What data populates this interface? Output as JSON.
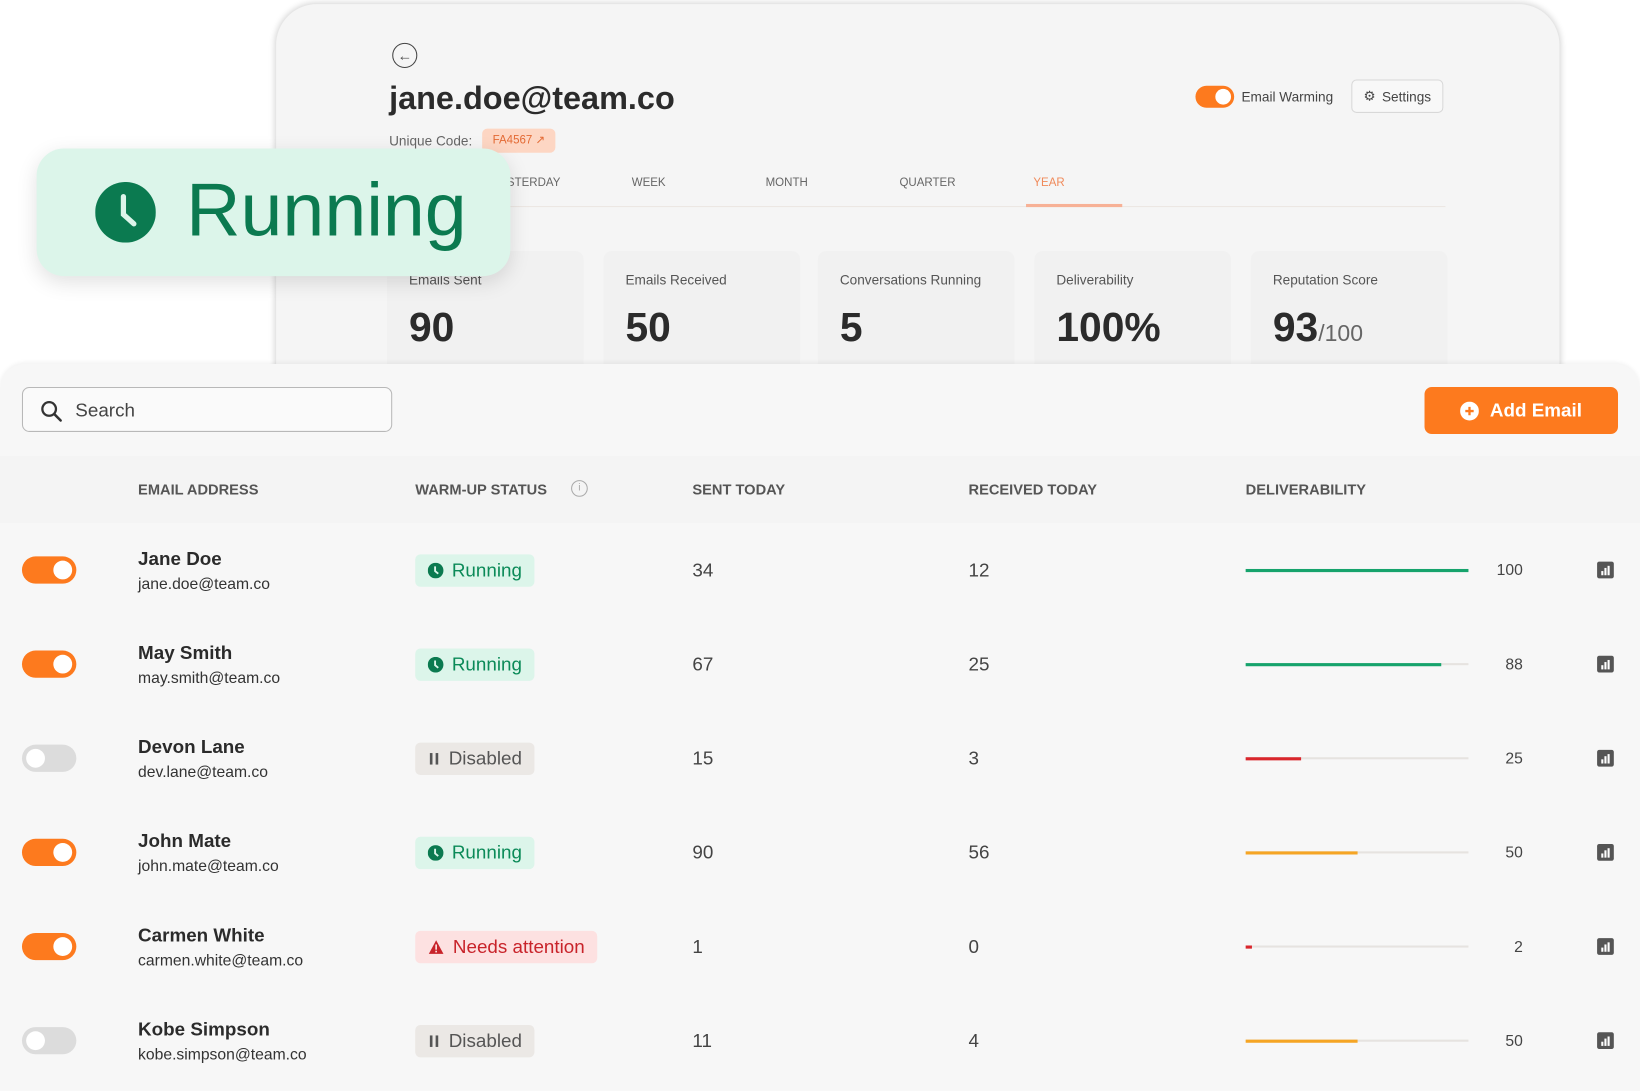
{
  "detail": {
    "title": "jane.doe@team.co",
    "unique_code_label": "Unique Code:",
    "unique_code": "FA4567 ↗",
    "email_warming_label": "Email Warming",
    "email_warming_on": true,
    "settings_label": "Settings",
    "tabs": [
      {
        "label": "YESTERDAY",
        "active": false
      },
      {
        "label": "WEEK",
        "active": false
      },
      {
        "label": "MONTH",
        "active": false
      },
      {
        "label": "QUARTER",
        "active": false
      },
      {
        "label": "YEAR",
        "active": true
      }
    ],
    "stats": [
      {
        "label": "Emails Sent",
        "value": "90",
        "suffix": ""
      },
      {
        "label": "Emails Received",
        "value": "50",
        "suffix": ""
      },
      {
        "label": "Conversations Running",
        "value": "5",
        "suffix": ""
      },
      {
        "label": "Deliverability",
        "value": "100%",
        "suffix": ""
      },
      {
        "label": "Reputation Score",
        "value": "93",
        "suffix": "/100"
      }
    ]
  },
  "callout": {
    "label": "Running",
    "icon": "clock-icon"
  },
  "toolbar": {
    "search_placeholder": "Search",
    "add_label": "Add Email"
  },
  "table": {
    "headers": [
      "EMAIL ADDRESS",
      "WARM-UP STATUS",
      "SENT TODAY",
      "RECEIVED TODAY",
      "DELIVERABILITY"
    ],
    "rows": [
      {
        "enabled": true,
        "name": "Jane Doe",
        "email": "jane.doe@team.co",
        "status": "Running",
        "sent": "34",
        "received": "12",
        "deliverability": 100
      },
      {
        "enabled": true,
        "name": "May Smith",
        "email": "may.smith@team.co",
        "status": "Running",
        "sent": "67",
        "received": "25",
        "deliverability": 88
      },
      {
        "enabled": false,
        "name": "Devon Lane",
        "email": "dev.lane@team.co",
        "status": "Disabled",
        "sent": "15",
        "received": "3",
        "deliverability": 25
      },
      {
        "enabled": true,
        "name": "John Mate",
        "email": "john.mate@team.co",
        "status": "Running",
        "sent": "90",
        "received": "56",
        "deliverability": 50
      },
      {
        "enabled": true,
        "name": "Carmen White",
        "email": "carmen.white@team.co",
        "status": "Needs attention",
        "sent": "1",
        "received": "0",
        "deliverability": 2
      },
      {
        "enabled": false,
        "name": "Kobe Simpson",
        "email": "kobe.simpson@team.co",
        "status": "Disabled",
        "sent": "11",
        "received": "4",
        "deliverability": 50
      }
    ]
  },
  "colors": {
    "accent": "#fd7a1e",
    "running": "#0b8a58",
    "good": "#16a36c",
    "warn": "#f5a524",
    "bad": "#d9262c"
  }
}
